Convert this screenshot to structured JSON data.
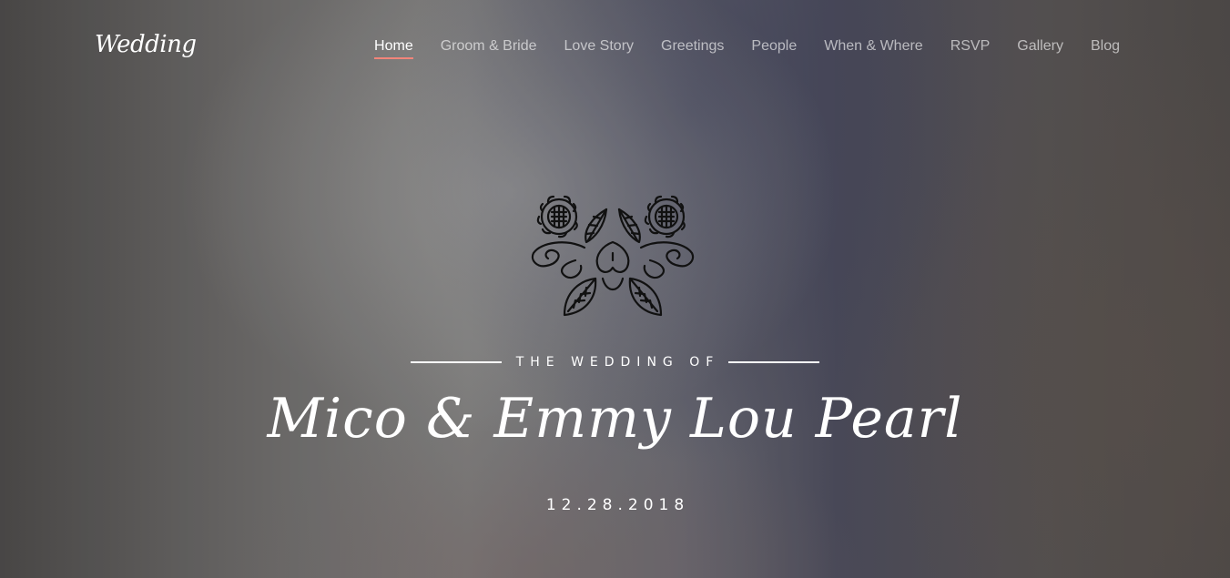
{
  "header": {
    "logo": "Wedding",
    "nav": [
      {
        "label": "Home",
        "active": true
      },
      {
        "label": "Groom & Bride",
        "active": false
      },
      {
        "label": "Love Story",
        "active": false
      },
      {
        "label": "Greetings",
        "active": false
      },
      {
        "label": "People",
        "active": false
      },
      {
        "label": "When & Where",
        "active": false
      },
      {
        "label": "RSVP",
        "active": false
      },
      {
        "label": "Gallery",
        "active": false
      },
      {
        "label": "Blog",
        "active": false
      }
    ]
  },
  "hero": {
    "emblem_icon": "floral-ornament-icon",
    "subtitle": "THE WEDDING OF",
    "couple": "Mico & Emmy Lou Pearl",
    "date": "12.28.2018"
  },
  "colors": {
    "accent": "#f2857a",
    "text": "#ffffff",
    "nav_inactive": "rgba(255,255,255,0.62)"
  }
}
